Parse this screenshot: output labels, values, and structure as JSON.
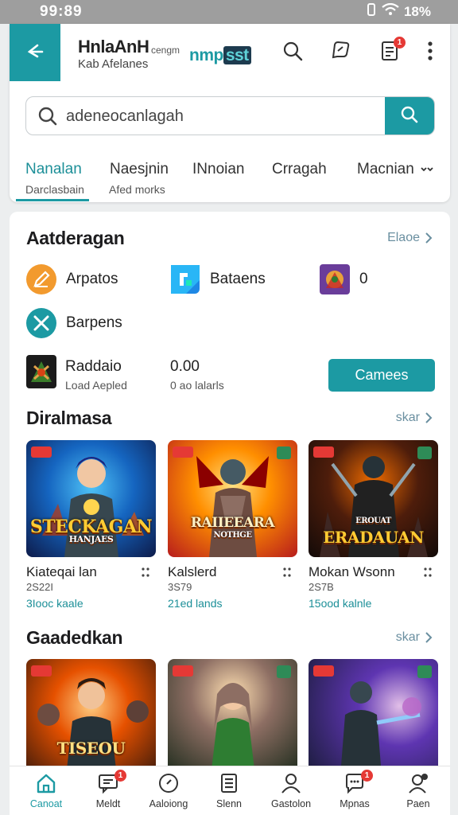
{
  "status": {
    "time": "99:89",
    "battery": "18%"
  },
  "header": {
    "title": "HnlaAnH",
    "subtitle": "Kab Afelanes",
    "brand_small": "cengm",
    "brand_logo_a": "nmp",
    "brand_logo_b": "sst",
    "notification_count": "1"
  },
  "search": {
    "placeholder": "adeneocanlagah"
  },
  "tabs": [
    {
      "label": "Nanalan",
      "sub": "Darclasbain"
    },
    {
      "label": "Naesjnin",
      "sub": "Afed morks"
    },
    {
      "label": "INnoian"
    },
    {
      "label": "Crragah"
    },
    {
      "label": "Macnian"
    }
  ],
  "sections": {
    "categories": {
      "title": "Aatderagan",
      "more": "Elaoe"
    },
    "popular": {
      "title": "Diralmasa",
      "more": "skar"
    },
    "more": {
      "title": "Gaadedkan",
      "more": "skar"
    }
  },
  "categories": [
    {
      "label": "Arpatos",
      "icon": "pencil-icon",
      "color": "#f29a2e"
    },
    {
      "label": "Bataens",
      "icon": "cube-icon",
      "color": "#1e88e5"
    },
    {
      "label": "0",
      "icon": "game-thumb-icon",
      "color": "#6a3d9a"
    },
    {
      "label": "Barpens",
      "icon": "crossed-swords-icon",
      "color": "#1c9aa3"
    }
  ],
  "featured": {
    "title": "Raddaio",
    "sub": "Load Aepled",
    "value": "0.00",
    "value_sub": "0 ao lalarls",
    "button": "Camees"
  },
  "popular_games": [
    {
      "name": "Kiateqai lan",
      "year": "2S22I",
      "tagline": "3Iooc kaale",
      "logo": "STECKAGAN",
      "logo_sub": "HANJAES"
    },
    {
      "name": "Kalslerd",
      "year": "3S79",
      "tagline": "21ed lands",
      "logo": "RAIIEEARA",
      "logo_sub": "NOTHGE"
    },
    {
      "name": "Mokan Wsonn",
      "year": "2S7B",
      "tagline": "15ood kalnle",
      "logo": "ERADAUAN",
      "logo_sub": "EROUAT"
    }
  ],
  "more_games": [
    {
      "logo": "TISEOU"
    },
    {
      "logo": ""
    },
    {
      "logo": ""
    }
  ],
  "bottom_nav": [
    {
      "label": "Canoat",
      "icon": "home-icon",
      "badge": ""
    },
    {
      "label": "Meldt",
      "icon": "chat-icon",
      "badge": "1"
    },
    {
      "label": "Aaloiong",
      "icon": "compass-icon",
      "badge": ""
    },
    {
      "label": "Slenn",
      "icon": "list-icon",
      "badge": ""
    },
    {
      "label": "Gastolon",
      "icon": "person-icon",
      "badge": ""
    },
    {
      "label": "Mpnas",
      "icon": "message-icon",
      "badge": "1"
    },
    {
      "label": "Paen",
      "icon": "profile-icon",
      "badge": ""
    }
  ],
  "colors": {
    "accent": "#1c9aa3",
    "badge": "#e53935"
  }
}
